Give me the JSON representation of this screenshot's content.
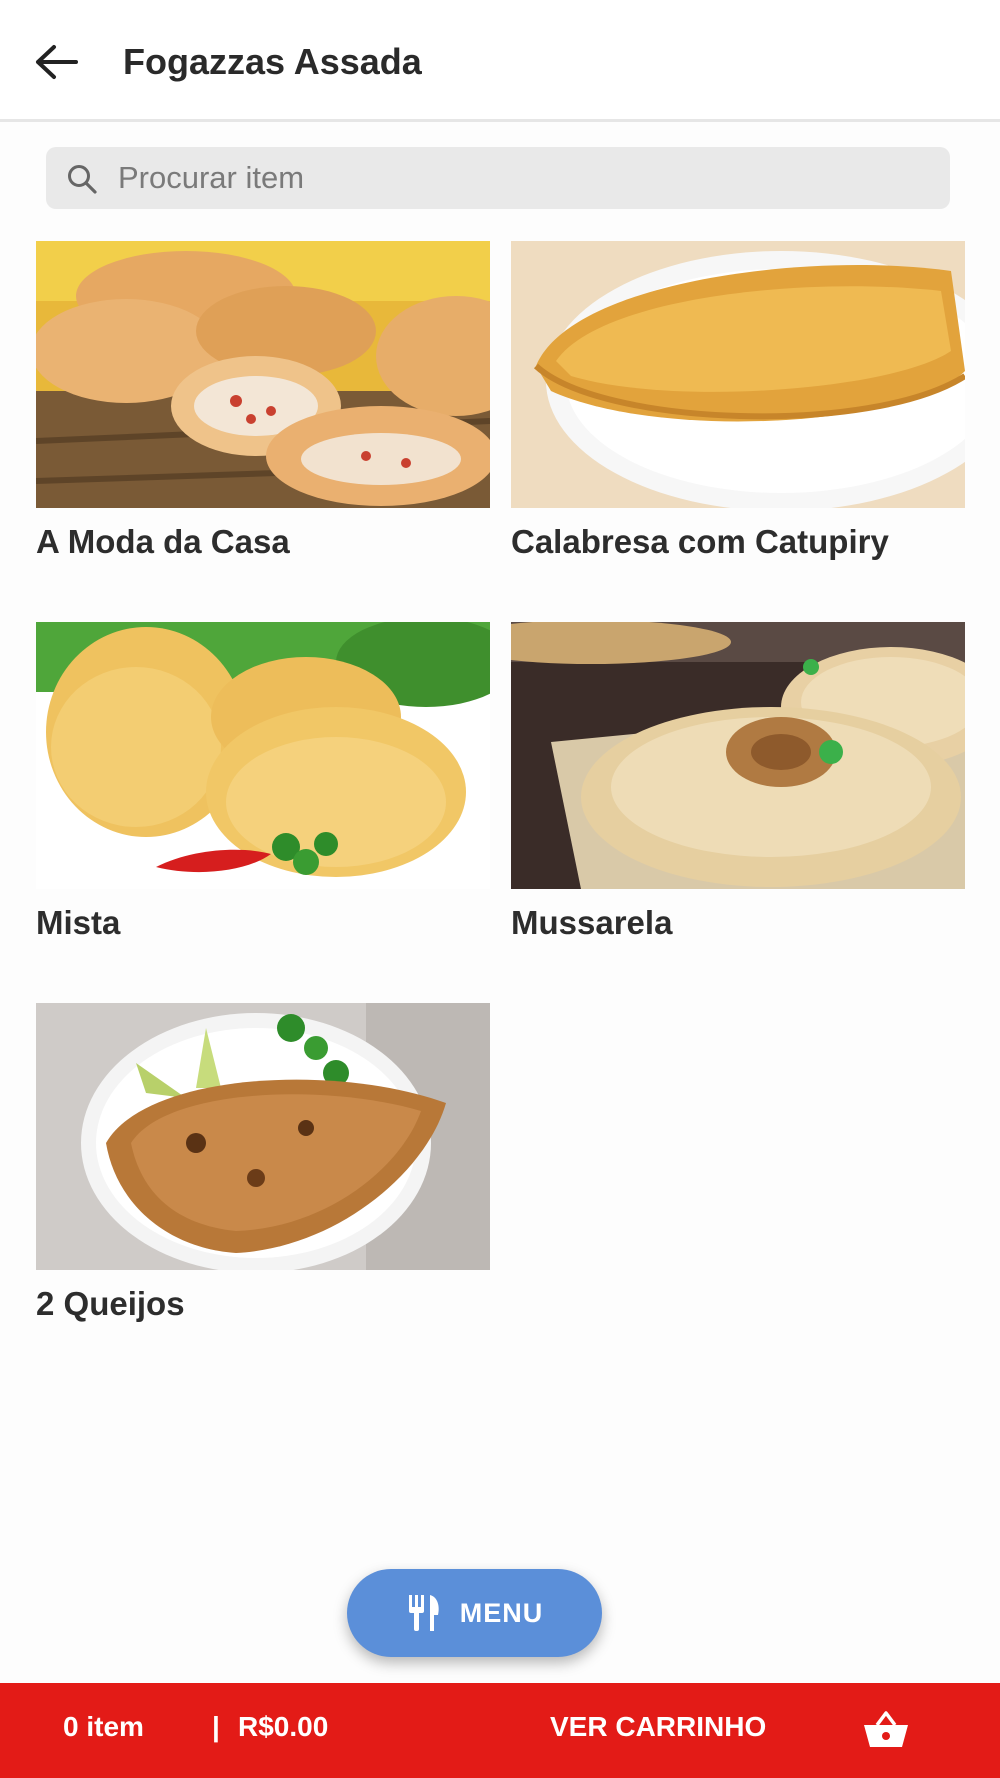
{
  "header": {
    "title": "Fogazzas Assada",
    "back_icon": "arrow-left-icon"
  },
  "search": {
    "placeholder": "Procurar item",
    "value": "",
    "icon": "search-icon"
  },
  "items": [
    {
      "label": "A Moda da Casa"
    },
    {
      "label": "Calabresa com Catupiry"
    },
    {
      "label": "Mista"
    },
    {
      "label": "Mussarela"
    },
    {
      "label": "2 Queijos"
    }
  ],
  "menu_button": {
    "label": "MENU",
    "icon": "cutlery-icon",
    "color": "#5b8fd9"
  },
  "cart_bar": {
    "item_count": "0 item",
    "separator": "|",
    "total": "R$0.00",
    "view_cart": "VER CARRINHO",
    "icon": "basket-icon",
    "color": "#e31b17"
  }
}
